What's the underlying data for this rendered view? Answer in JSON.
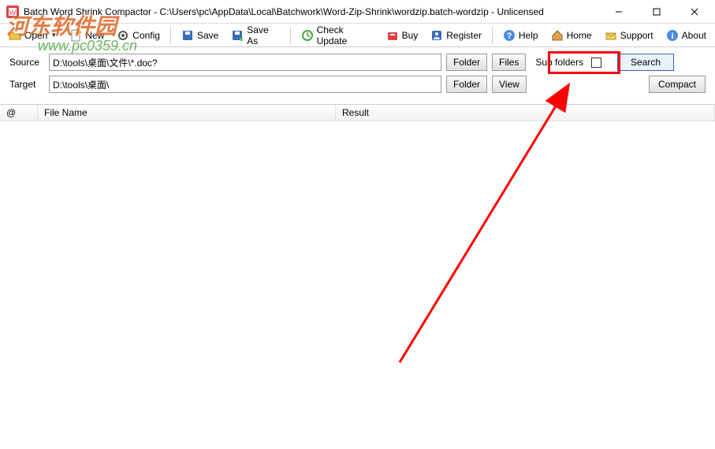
{
  "title": "Batch Word Shrink Compactor - C:\\Users\\pc\\AppData\\Local\\Batchwork\\Word-Zip-Shrink\\wordzip.batch-wordzip - Unlicensed",
  "toolbar": {
    "open": "Open",
    "new": "New",
    "config": "Config",
    "save": "Save",
    "saveas": "Save As",
    "checkupdate": "Check Update",
    "buy": "Buy",
    "register": "Register",
    "help": "Help",
    "home": "Home",
    "support": "Support",
    "about": "About"
  },
  "form": {
    "source_label": "Source",
    "source_value": "D:\\tools\\桌面\\文件\\*.doc?",
    "target_label": "Target",
    "target_value": "D:\\tools\\桌面\\",
    "folder_btn": "Folder",
    "files_btn": "Files",
    "view_btn": "View",
    "subfolders_label": "Sub folders",
    "search_btn": "Search",
    "compact_btn": "Compact"
  },
  "table": {
    "col_at": "@",
    "col_filename": "File Name",
    "col_result": "Result"
  },
  "watermark": {
    "line1": "河东软件园",
    "line2": "www.pc0359.cn"
  }
}
